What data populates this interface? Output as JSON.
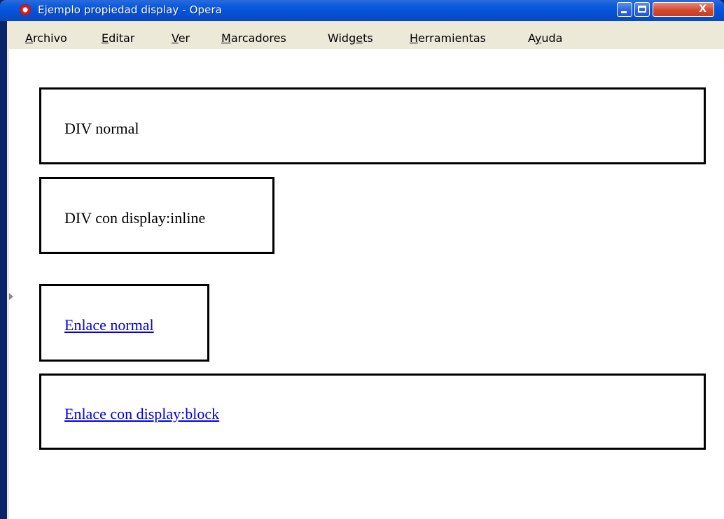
{
  "window": {
    "title": "Ejemplo propiedad display - Opera",
    "app_icon": "opera-icon",
    "controls": {
      "minimize": "minimize-icon",
      "maximize": "maximize-icon",
      "close": "close-icon",
      "close_glyph": "X"
    }
  },
  "menubar": {
    "items": [
      {
        "accel": "A",
        "rest": "rchivo"
      },
      {
        "accel": "E",
        "rest": "ditar"
      },
      {
        "accel": "V",
        "rest": "er"
      },
      {
        "accel": "M",
        "rest": "arcadores"
      },
      {
        "pre": "Widg",
        "accel": "e",
        "rest": "ts"
      },
      {
        "accel": "H",
        "rest": "erramientas"
      },
      {
        "pre": "A",
        "accel": "y",
        "rest": "uda"
      }
    ]
  },
  "content": {
    "div_normal": "DIV normal",
    "div_inline": "DIV con display:inline",
    "link_normal": "Enlace normal",
    "link_block": "Enlace con display:block"
  },
  "colors": {
    "titlebar": "#0552d6",
    "menubar": "#ece9d8",
    "link": "#0000ee",
    "border": "#000000"
  }
}
